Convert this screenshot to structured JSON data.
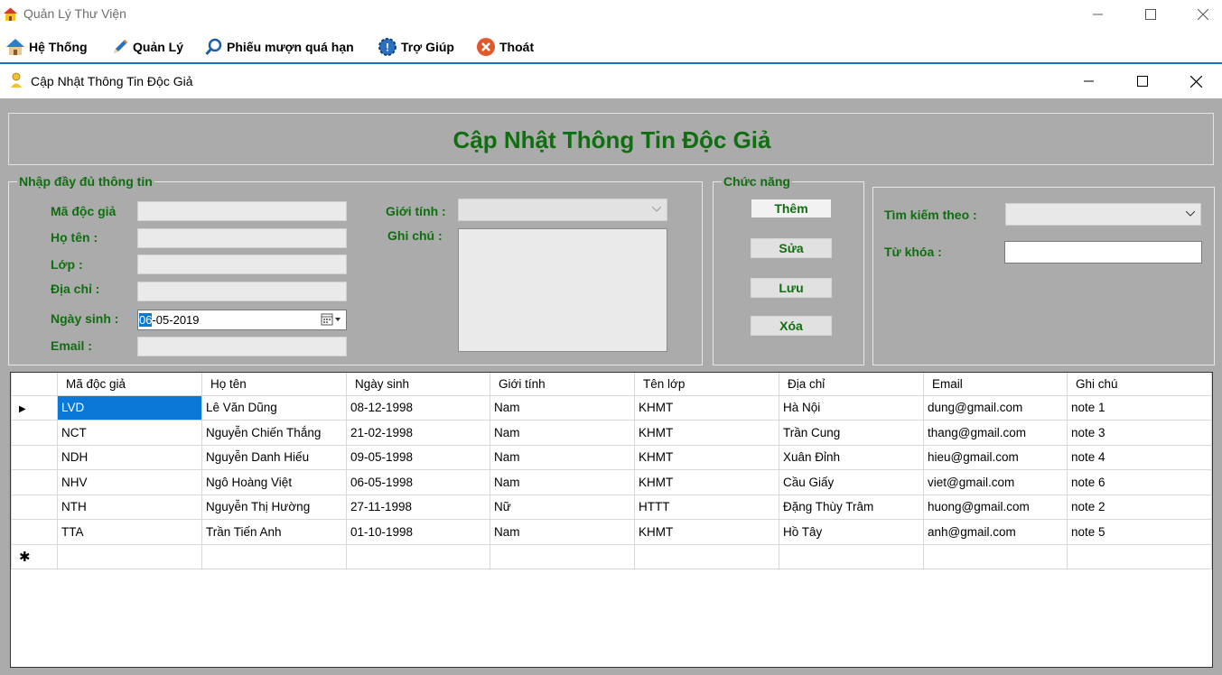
{
  "window": {
    "title": "Quản Lý Thư Viện"
  },
  "menu": {
    "items": [
      {
        "label": "Hệ Thống",
        "icon": "home-icon"
      },
      {
        "label": "Quản Lý",
        "icon": "pencil-icon"
      },
      {
        "label": "Phiếu mượn quá hạn",
        "icon": "magnifier-icon"
      },
      {
        "label": "Trợ Giúp",
        "icon": "help-gear-icon"
      },
      {
        "label": "Thoát",
        "icon": "exit-icon"
      }
    ]
  },
  "child_window": {
    "title": "Cập Nhật Thông Tin Độc Giả"
  },
  "form": {
    "header_title": "Cập Nhật Thông Tin Độc Giả",
    "info_group": {
      "legend": "Nhập đầy đủ thông tin",
      "labels": {
        "ma_doc_gia": "Mã độc giả",
        "ho_ten": "Họ tên :",
        "lop": "Lớp :",
        "dia_chi": "Địa chỉ :",
        "ngay_sinh": "Ngày sinh :",
        "email": "Email :",
        "gioi_tinh": "Giới tính :",
        "ghi_chu": "Ghi chú :"
      },
      "values": {
        "ma_doc_gia": "",
        "ho_ten": "",
        "lop": "",
        "dia_chi": "",
        "ngay_sinh_selected": "06",
        "ngay_sinh_rest": "-05-2019",
        "email": "",
        "gioi_tinh": "",
        "ghi_chu": ""
      }
    },
    "function_group": {
      "legend": "Chức năng",
      "buttons": [
        "Thêm",
        "Sửa",
        "Lưu",
        "Xóa"
      ]
    },
    "search_group": {
      "search_by_label": "Tìm kiếm theo :",
      "search_by_value": "",
      "keyword_label": "Từ khóa :",
      "keyword_value": ""
    }
  },
  "grid": {
    "columns": [
      "Mã độc giả",
      "Họ tên",
      "Ngày sinh",
      "Giới tính",
      "Tên lớp",
      "Địa chỉ",
      "Email",
      "Ghi chú"
    ],
    "rows": [
      [
        "LVD",
        "Lê Văn Dũng",
        "08-12-1998",
        "Nam",
        "KHMT",
        "Hà Nội",
        "dung@gmail.com",
        "note 1"
      ],
      [
        "NCT",
        "Nguyễn Chiến Thắng",
        "21-02-1998",
        "Nam",
        "KHMT",
        "Trần Cung",
        "thang@gmail.com",
        "note 3"
      ],
      [
        "NDH",
        "Nguyễn Danh Hiếu",
        "09-05-1998",
        "Nam",
        "KHMT",
        "Xuân Đỉnh",
        "hieu@gmail.com",
        "note 4"
      ],
      [
        "NHV",
        "Ngô Hoàng Việt",
        "06-05-1998",
        "Nam",
        "KHMT",
        "Cầu Giấy",
        "viet@gmail.com",
        "note 6"
      ],
      [
        "NTH",
        "Nguyễn Thị Hường",
        "27-11-1998",
        "Nữ",
        "HTTT",
        "Đặng Thùy Trâm",
        "huong@gmail.com",
        "note 2"
      ],
      [
        "TTA",
        "Trần Tiến Anh",
        "01-10-1998",
        "Nam",
        "KHMT",
        "Hồ Tây",
        "anh@gmail.com",
        "note 5"
      ]
    ],
    "current_row_marker": "▶",
    "new_row_marker": "✱"
  }
}
